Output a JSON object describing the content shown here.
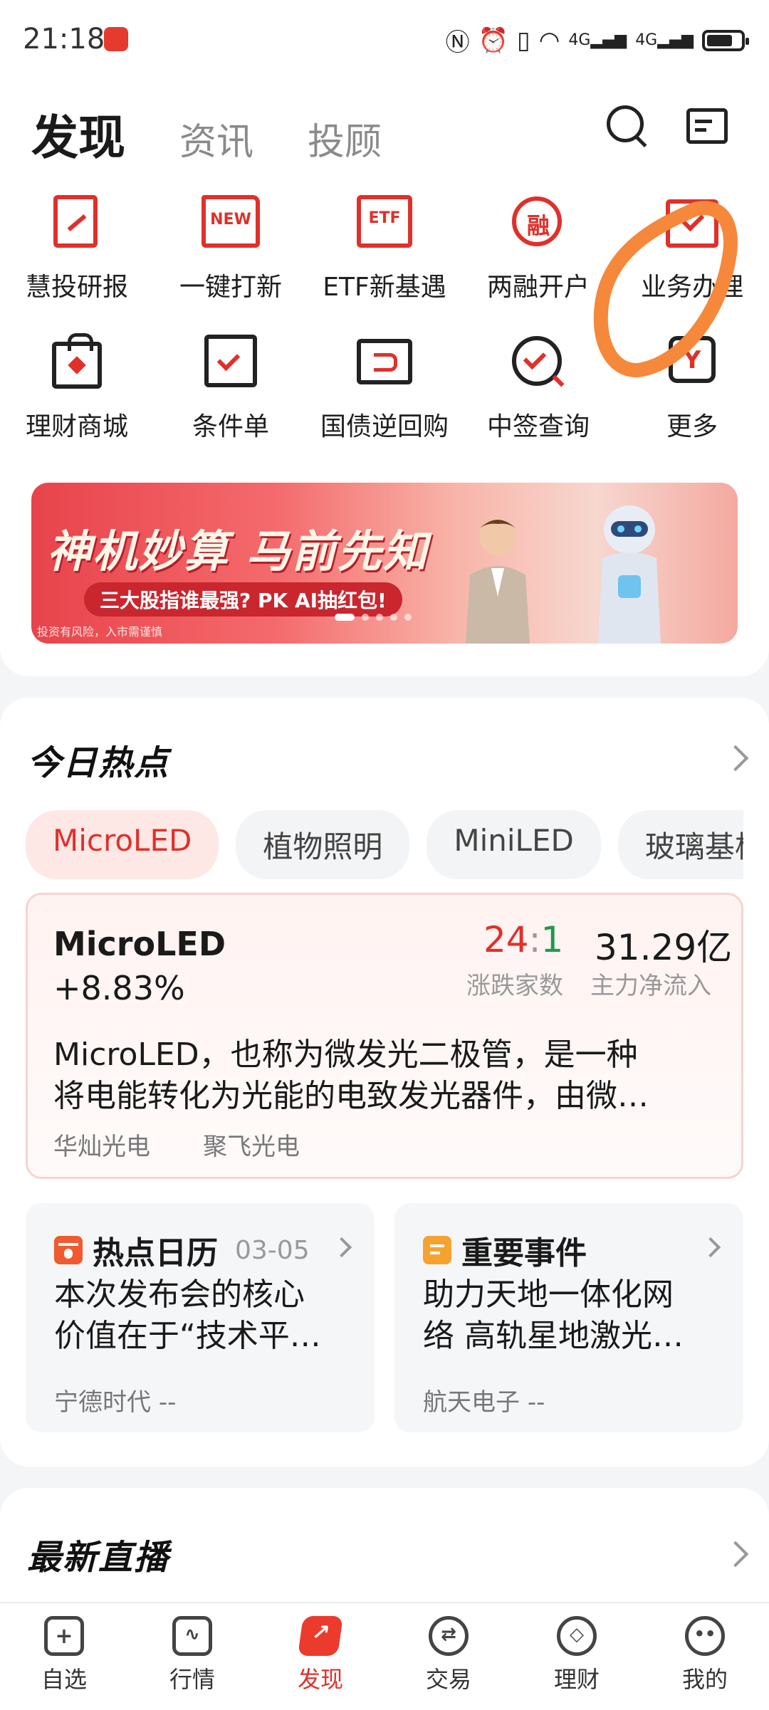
{
  "status": {
    "time": "21:18",
    "net1": "4G",
    "net2": "4G"
  },
  "tabs": [
    {
      "label": "发现"
    },
    {
      "label": "资讯"
    },
    {
      "label": "投顾"
    }
  ],
  "grid": [
    {
      "label": "慧投研报",
      "icon": "report-pen-icon"
    },
    {
      "label": "一键打新",
      "icon": "new-folder-icon",
      "badge": "NEW"
    },
    {
      "label": "ETF新基遇",
      "icon": "etf-doc-icon",
      "badge": "ETF"
    },
    {
      "label": "两融开户",
      "icon": "margin-account-icon",
      "badge": "融"
    },
    {
      "label": "业务办理",
      "icon": "business-check-icon"
    },
    {
      "label": "理财商城",
      "icon": "shopping-bag-icon"
    },
    {
      "label": "条件单",
      "icon": "condition-order-icon"
    },
    {
      "label": "国债逆回购",
      "icon": "bond-repo-icon"
    },
    {
      "label": "中签查询",
      "icon": "lottery-query-icon"
    },
    {
      "label": "更多",
      "icon": "more-hex-icon",
      "badge": "Y"
    }
  ],
  "banner": {
    "title": "神机妙算 马前先知",
    "subtitle": "三大股指谁最强? PK AI抽红包!",
    "risk": "投资有风险，入市需谨慎"
  },
  "hot": {
    "title": "今日热点",
    "chips": [
      "MicroLED",
      "植物照明",
      "MiniLED",
      "玻璃基板"
    ],
    "topic": {
      "name": "MicroLED",
      "change": "+8.83%",
      "up": "24",
      "sep": ":",
      "down": "1",
      "ratio_label": "涨跌家数",
      "flow": "31.29亿",
      "flow_label": "主力净流入",
      "desc_line1": "MicroLED，也称为微发光二极管，是一种",
      "desc_line2": "将电能转化为光能的电致发光器件，由微…",
      "stocks": [
        "华灿光电",
        "聚飞光电"
      ]
    },
    "calendar": {
      "title": "热点日历",
      "date": "03-05",
      "line1": "本次发布会的核心",
      "line2": "价值在于“技术平…",
      "stock": "宁德时代",
      "value": "--"
    },
    "events": {
      "title": "重要事件",
      "line1": "助力天地一体化网",
      "line2": "络  高轨星地激光…",
      "stock": "航天电子",
      "value": "--"
    }
  },
  "live": {
    "title": "最新直播"
  },
  "nav": [
    {
      "label": "自选",
      "icon": "watchlist-icon"
    },
    {
      "label": "行情",
      "icon": "market-icon"
    },
    {
      "label": "发现",
      "icon": "discover-icon"
    },
    {
      "label": "交易",
      "icon": "trade-icon"
    },
    {
      "label": "理财",
      "icon": "wealth-icon"
    },
    {
      "label": "我的",
      "icon": "profile-icon"
    }
  ],
  "colors": {
    "accent": "#e0302a",
    "down": "#1d9a4c",
    "highlight": "#f5883a"
  }
}
